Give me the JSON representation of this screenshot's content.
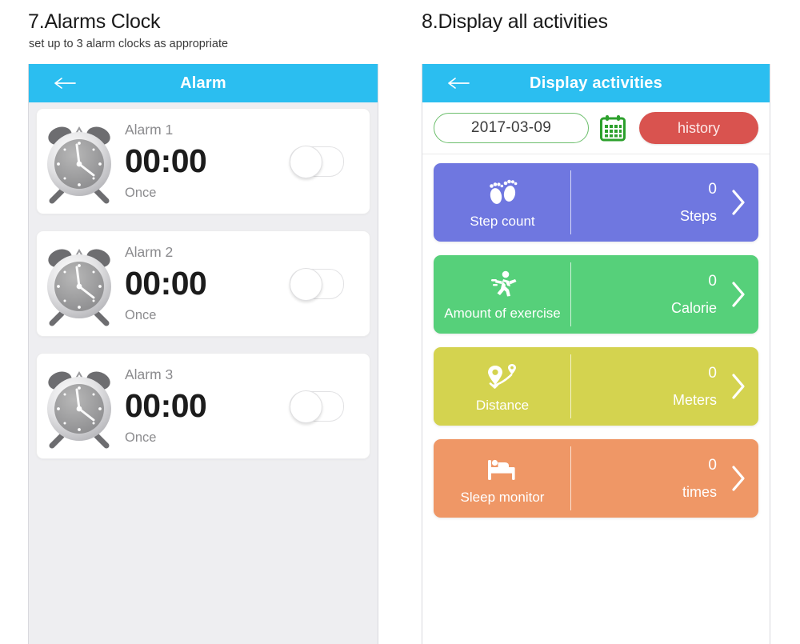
{
  "sections": [
    {
      "heading": "7.Alarms Clock",
      "subheading": "set up to 3 alarm clocks as appropriate"
    },
    {
      "heading": "8.Display all activities",
      "subheading": ""
    }
  ],
  "alarm_screen": {
    "appbar": {
      "title": "Alarm",
      "back_icon": "back-arrow-icon"
    },
    "alarms": [
      {
        "name": "Alarm 1",
        "time": "00:00",
        "repeat": "Once",
        "enabled": false,
        "icon": "alarm-clock-icon"
      },
      {
        "name": "Alarm 2",
        "time": "00:00",
        "repeat": "Once",
        "enabled": false,
        "icon": "alarm-clock-icon"
      },
      {
        "name": "Alarm 3",
        "time": "00:00",
        "repeat": "Once",
        "enabled": false,
        "icon": "alarm-clock-icon"
      }
    ]
  },
  "activities_screen": {
    "appbar": {
      "title": "Display activities",
      "back_icon": "back-arrow-icon"
    },
    "date_picker": {
      "value": "2017-03-09",
      "calendar_icon": "calendar-icon",
      "border_color": "#6dbf6d"
    },
    "history_button": {
      "label": "history",
      "color": "#d9534f"
    },
    "activities": [
      {
        "label": "Step count",
        "icon": "footprints-icon",
        "value": "0",
        "unit": "Steps",
        "color": "#6f77e0"
      },
      {
        "label": "Amount of exercise",
        "icon": "running-icon",
        "value": "0",
        "unit": "Calorie",
        "color": "#56d07a"
      },
      {
        "label": "Distance",
        "icon": "map-route-icon",
        "value": "0",
        "unit": "Meters",
        "color": "#d4d34f"
      },
      {
        "label": "Sleep monitor",
        "icon": "bed-icon",
        "value": "0",
        "unit": "times",
        "color": "#ef9766"
      }
    ]
  },
  "theme": {
    "appbar_color": "#2bbef0",
    "panel_bg_left": "#eeeef1",
    "panel_bg_right": "#ffffff"
  }
}
